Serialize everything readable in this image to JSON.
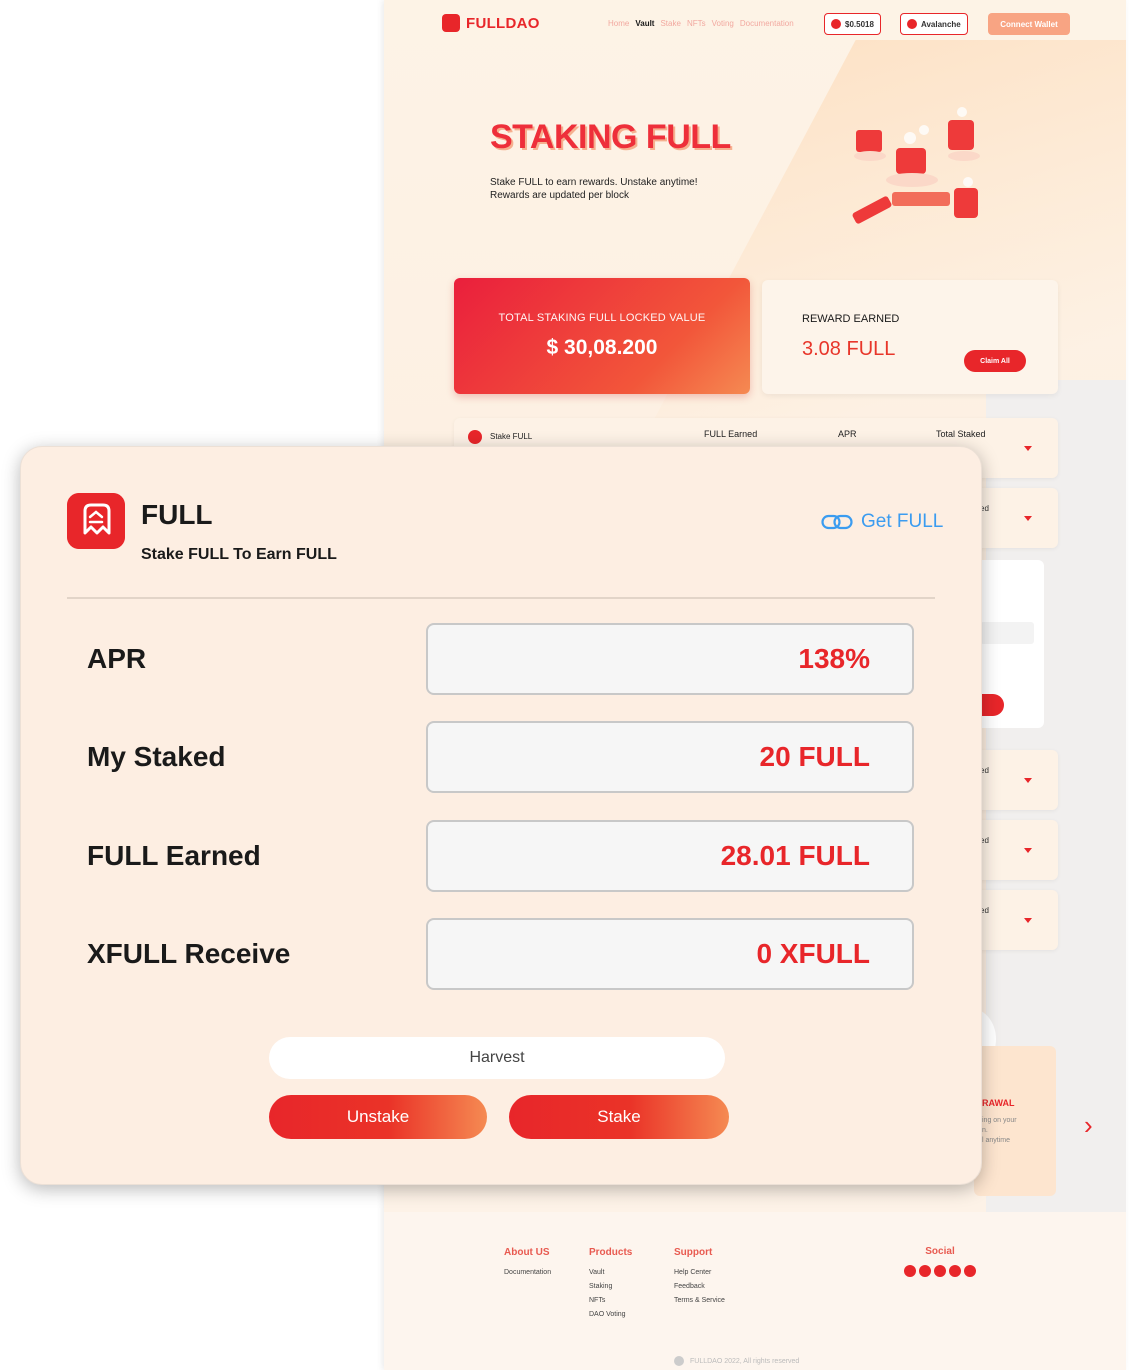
{
  "bg": {
    "brand": "FULLDAO",
    "nav": [
      "Home",
      "Vault",
      "Stake",
      "NFTs",
      "Voting",
      "Documentation"
    ],
    "nav_active": "Vault",
    "price": "$0.5018",
    "network": "Avalanche",
    "connect_label": "Connect Wallet",
    "hero_title": "STAKING FULL",
    "hero_line1": "Stake FULL to earn rewards. Unstake anytime!",
    "hero_line2": "Rewards are updated per block",
    "tvl_label": "TOTAL STAKING FULL LOCKED VALUE",
    "tvl_value": "$ 30,08.200",
    "reward_label": "REWARD EARNED",
    "reward_value": "3.08 FULL",
    "claim_label": "Claim All",
    "table_headers": [
      "Stake FULL",
      "FULL Earned",
      "APR",
      "Total Staked"
    ],
    "row_fragment": "ed",
    "withdraw_title": "RAWAL",
    "withdraw_desc_1": "ing on your",
    "withdraw_desc_2": "n.",
    "withdraw_desc_3": "l anytime",
    "footer": {
      "about": {
        "title": "About US",
        "links": [
          "Documentation"
        ]
      },
      "products": {
        "title": "Products",
        "links": [
          "Vault",
          "Staking",
          "NFTs",
          "DAO Voting"
        ]
      },
      "support": {
        "title": "Support",
        "links": [
          "Help Center",
          "Feedback",
          "Terms & Service"
        ]
      },
      "social": "Social",
      "copyright": "FULLDAO 2022, All rights reserved"
    }
  },
  "modal": {
    "title": "FULL",
    "subtitle": "Stake FULL To Earn FULL",
    "get_link": "Get FULL",
    "rows": [
      {
        "label": "APR",
        "value": "138%"
      },
      {
        "label": "My Staked",
        "value": "20 FULL"
      },
      {
        "label": "FULL Earned",
        "value": "28.01 FULL"
      },
      {
        "label": "XFULL Receive",
        "value": "0 XFULL"
      }
    ],
    "harvest_label": "Harvest",
    "unstake_label": "Unstake",
    "stake_label": "Stake"
  },
  "colors": {
    "brand_red": "#e8262a",
    "link_blue": "#3b9cf0",
    "modal_bg": "#fdeee2"
  }
}
